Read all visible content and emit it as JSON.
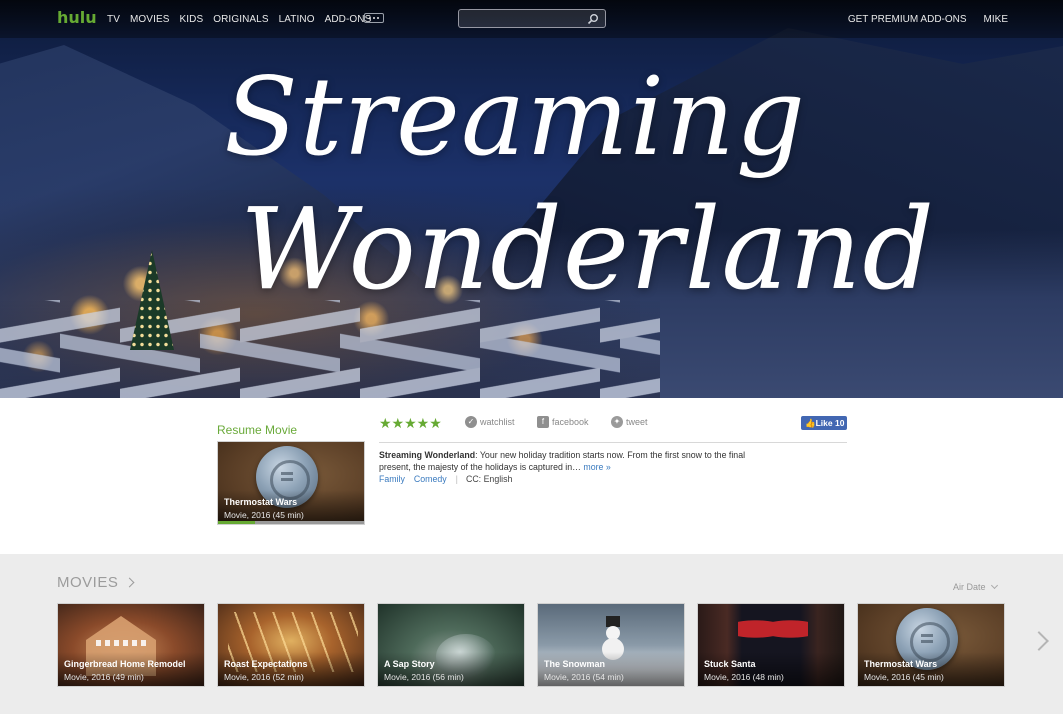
{
  "nav": {
    "logo": "hulu",
    "links": [
      "TV",
      "MOVIES",
      "KIDS",
      "ORIGINALS",
      "LATINO",
      "ADD-ONS"
    ],
    "search_placeholder": "",
    "right_links": [
      "GET PREMIUM ADD-ONS",
      "MIKE"
    ]
  },
  "hero": {
    "title_line1": "Streaming",
    "title_line2": "Wonderland"
  },
  "details": {
    "resume_label": "Resume Movie",
    "resume_thumb": {
      "title": "Thermostat Wars",
      "meta": "Movie, 2016 (45 min)",
      "progress": 0.25
    },
    "rating_stars": 5,
    "stars_text": "★★★★★",
    "actions": {
      "watchlist": "watchlist",
      "facebook": "facebook",
      "tweet": "tweet",
      "like": "Like 10"
    },
    "description_title": "Streaming Wonderland",
    "description_body": ": Your new holiday tradition starts now. From the first snow to the final present, the majesty of the holidays is captured in…",
    "more_label": "more »",
    "tags": [
      "Family",
      "Comedy"
    ],
    "cc": "CC: English"
  },
  "movies": {
    "heading": "MOVIES",
    "sort_label": "Air Date",
    "items": [
      {
        "title": "Gingerbread Home Remodel",
        "meta": "Movie, 2016 (49 min)"
      },
      {
        "title": "Roast Expectations",
        "meta": "Movie, 2016 (52 min)"
      },
      {
        "title": "A Sap Story",
        "meta": "Movie, 2016 (56 min)"
      },
      {
        "title": "The Snowman",
        "meta": "Movie, 2016 (54 min)"
      },
      {
        "title": "Stuck Santa",
        "meta": "Movie, 2016 (48 min)"
      },
      {
        "title": "Thermostat Wars",
        "meta": "Movie, 2016 (45 min)"
      }
    ]
  },
  "colors": {
    "brand_green": "#66aa33",
    "link_blue": "#3b7bbf",
    "facebook_blue": "#4267b2"
  }
}
